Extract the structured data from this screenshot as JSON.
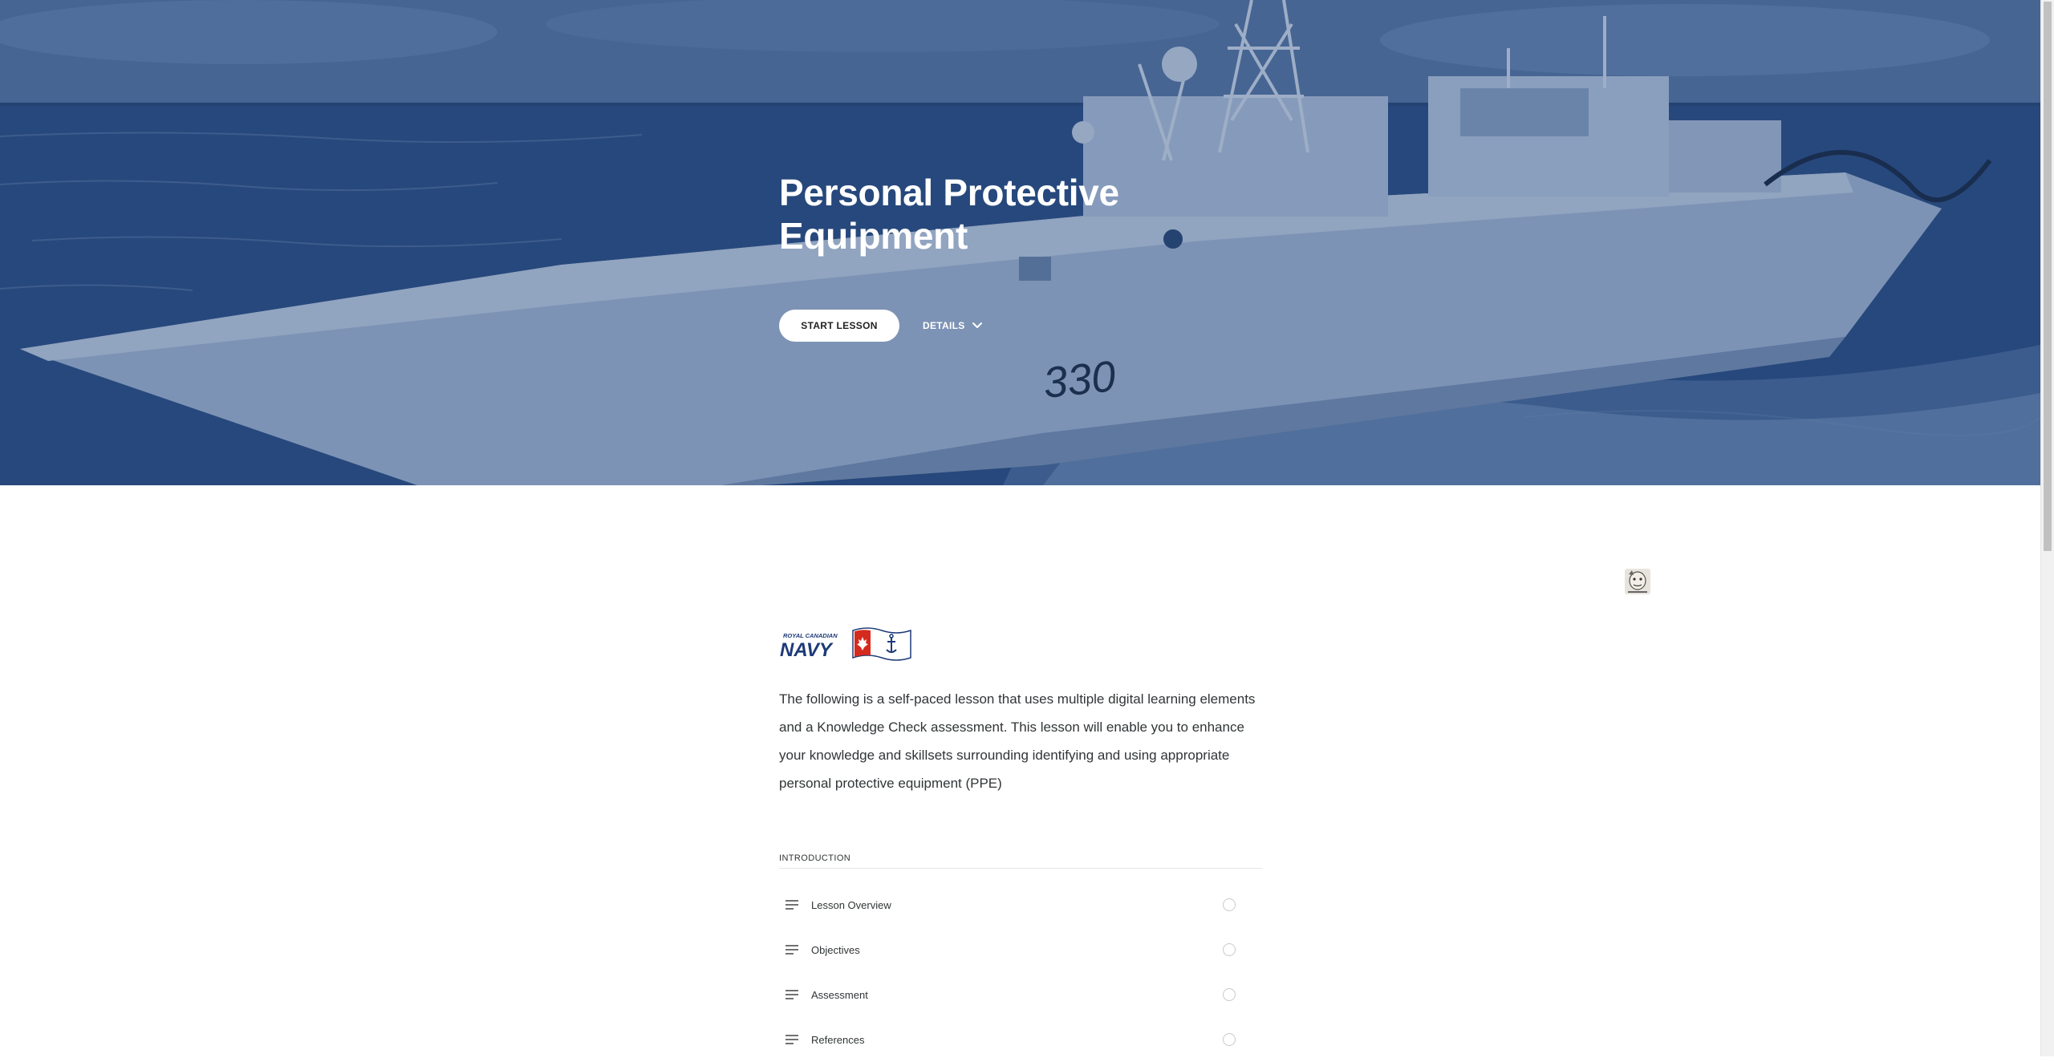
{
  "hero": {
    "title": "Personal Protective Equipment",
    "start_label": "START LESSON",
    "details_label": "DETAILS",
    "hull_number": "330",
    "overlay_color": "#1f3f74"
  },
  "logo": {
    "line1": "ROYAL CANADIAN",
    "line2": "NAVY"
  },
  "intro": {
    "text": "The following is a self-paced lesson that uses multiple digital learning elements and a Knowledge Check assessment. This lesson will enable you to enhance your knowledge and skillsets surrounding identifying and using appropriate personal protective equipment (PPE)"
  },
  "outline": {
    "section_title": "INTRODUCTION",
    "items": [
      {
        "label": "Lesson Overview",
        "icon": "text-lines-icon",
        "status": "incomplete"
      },
      {
        "label": "Objectives",
        "icon": "text-lines-icon",
        "status": "incomplete"
      },
      {
        "label": "Assessment",
        "icon": "text-lines-icon",
        "status": "incomplete"
      },
      {
        "label": "References",
        "icon": "text-lines-icon",
        "status": "incomplete"
      }
    ]
  },
  "colors": {
    "hero_blue": "#2d4e7f",
    "text": "#313537",
    "button_bg": "#ffffff"
  }
}
